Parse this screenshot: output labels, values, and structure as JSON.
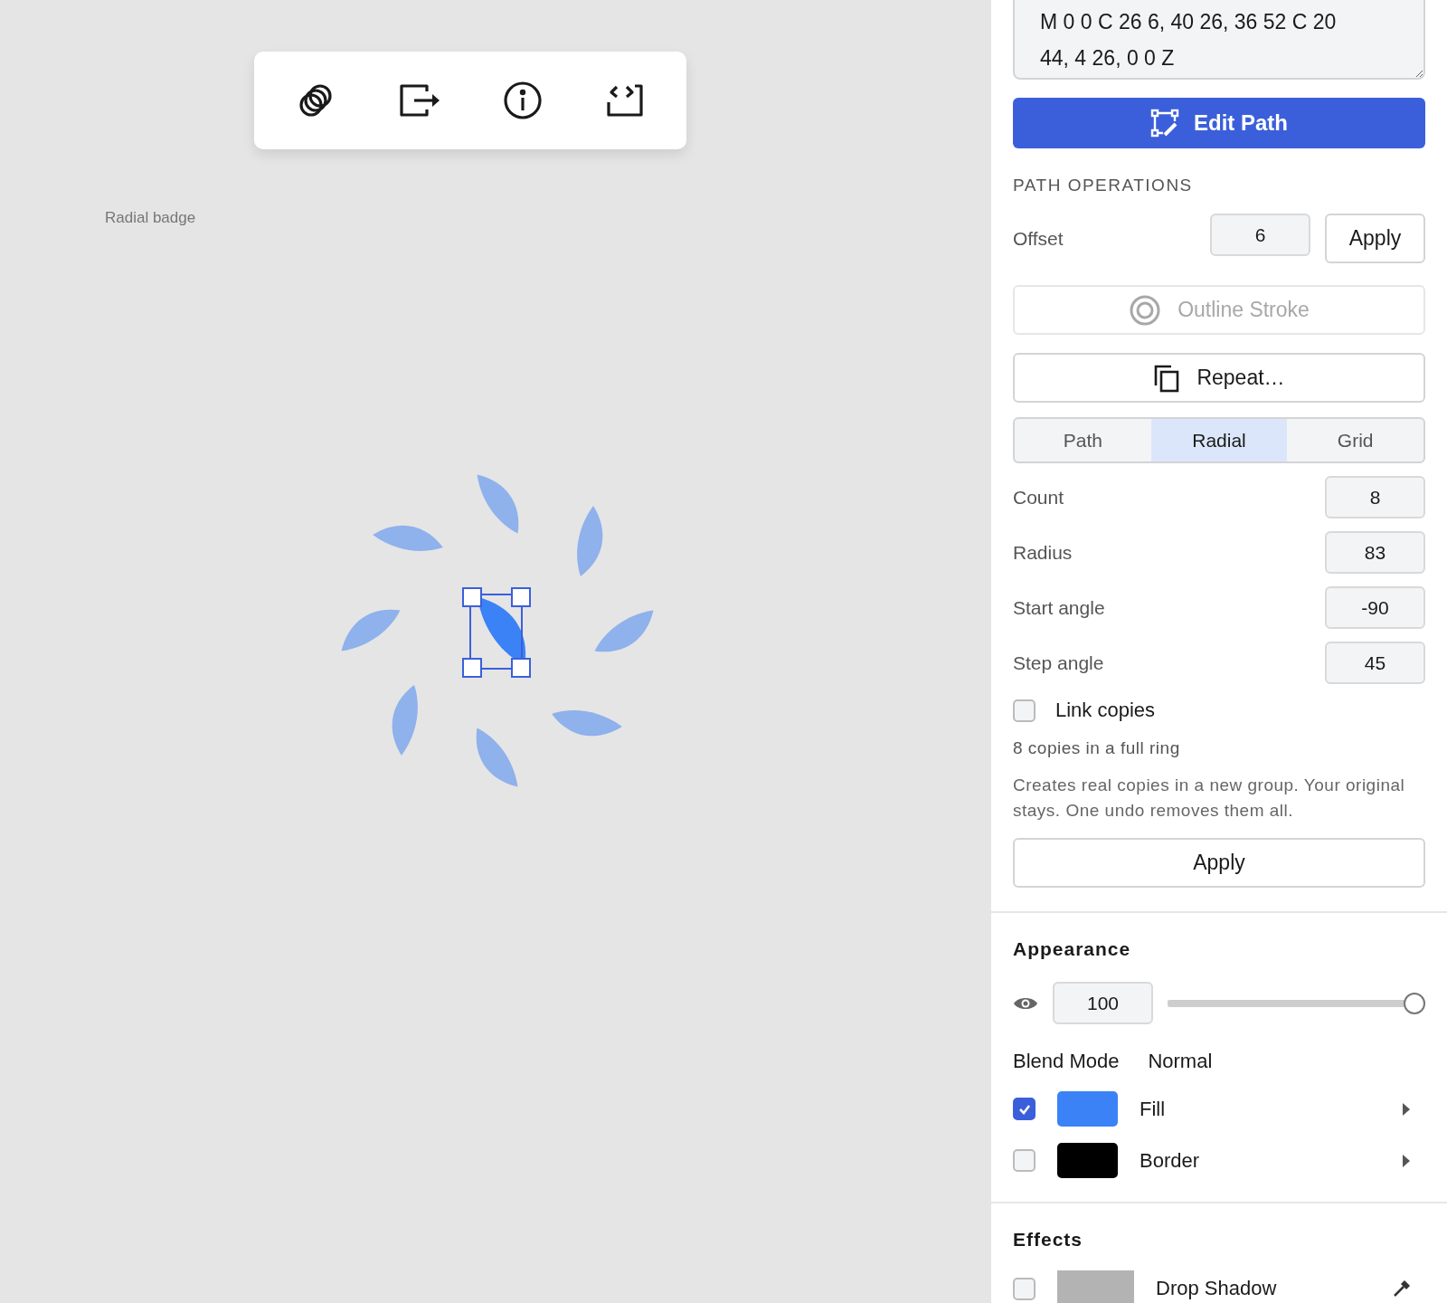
{
  "canvas": {
    "label": "Radial badge"
  },
  "path_field": {
    "value": "M 0 0 C 26 6, 40 26, 36 52 C 20 44, 4 26, 0 0 Z"
  },
  "edit_path_button": "Edit Path",
  "path_operations": {
    "heading": "PATH OPERATIONS",
    "offset": {
      "label": "Offset",
      "value": "6",
      "button": "Apply"
    },
    "outline_stroke": {
      "label": "Outline Stroke",
      "disabled": true
    },
    "repeat_button": "Repeat…"
  },
  "repeat": {
    "tabs": [
      {
        "label": "Path",
        "selected": false
      },
      {
        "label": "Radial",
        "selected": true
      },
      {
        "label": "Grid",
        "selected": false
      }
    ],
    "fields": [
      {
        "label": "Count",
        "value": "8"
      },
      {
        "label": "Radius",
        "value": "83"
      },
      {
        "label": "Start angle",
        "value": "-90"
      },
      {
        "label": "Step angle",
        "value": "45"
      }
    ],
    "link_copies": {
      "label": "Link copies",
      "checked": false
    },
    "summary": "8 copies in a full ring",
    "note": "Creates real copies in a new group. Your original stays. One undo removes them all.",
    "apply_button": "Apply"
  },
  "appearance": {
    "heading": "Appearance",
    "opacity": {
      "value": "100",
      "level": 1
    },
    "blend_mode": {
      "label": "Blend Mode",
      "value": "Normal"
    },
    "paints": [
      {
        "label": "Fill",
        "checked": true,
        "color": "#3b82f6"
      },
      {
        "label": "Border",
        "checked": false,
        "color": "#000000"
      }
    ]
  },
  "effects": {
    "heading": "Effects",
    "items": [
      {
        "label": "Drop Shadow",
        "checked": false,
        "color": "#b3b3b3"
      }
    ]
  }
}
